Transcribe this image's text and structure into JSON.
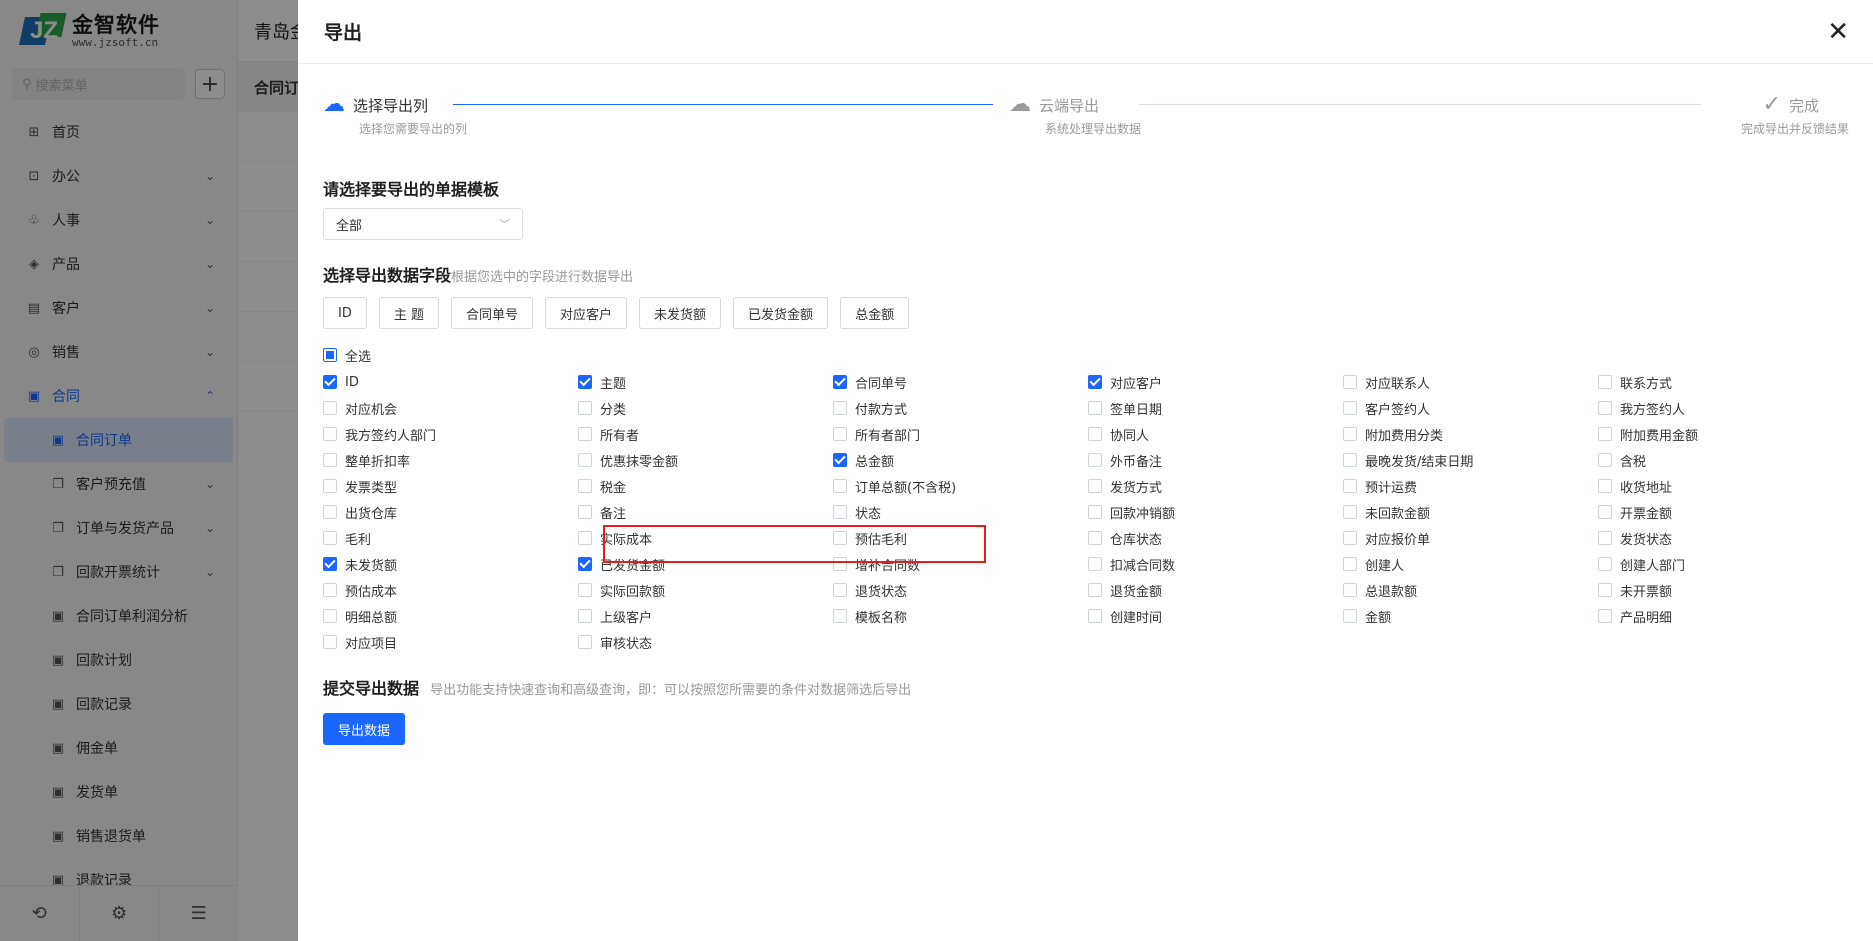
{
  "sidebar": {
    "logo_name": "金智软件",
    "logo_url": "www.jzsoft.cn",
    "search_placeholder": "搜索菜单",
    "items": [
      {
        "label": "首页",
        "icon": "⊞",
        "chev": ""
      },
      {
        "label": "办公",
        "icon": "⊡",
        "chev": "⌄"
      },
      {
        "label": "人事",
        "icon": "♧",
        "chev": "⌄"
      },
      {
        "label": "产品",
        "icon": "◈",
        "chev": "⌄"
      },
      {
        "label": "客户",
        "icon": "▤",
        "chev": "⌄"
      },
      {
        "label": "销售",
        "icon": "◎",
        "chev": "⌄"
      },
      {
        "label": "合同",
        "icon": "▣",
        "chev": "⌃"
      },
      {
        "label": "合同订单",
        "icon": "▣",
        "chev": ""
      },
      {
        "label": "客户预充值",
        "icon": "❐",
        "chev": "⌄"
      },
      {
        "label": "订单与发货产品",
        "icon": "❐",
        "chev": "⌄"
      },
      {
        "label": "回款开票统计",
        "icon": "❐",
        "chev": "⌄"
      },
      {
        "label": "合同订单利润分析",
        "icon": "▣",
        "chev": ""
      },
      {
        "label": "回款计划",
        "icon": "▣",
        "chev": ""
      },
      {
        "label": "回款记录",
        "icon": "▣",
        "chev": ""
      },
      {
        "label": "佣金单",
        "icon": "▣",
        "chev": ""
      },
      {
        "label": "发货单",
        "icon": "▣",
        "chev": ""
      },
      {
        "label": "销售退货单",
        "icon": "▣",
        "chev": ""
      },
      {
        "label": "退款记录",
        "icon": "▣",
        "chev": ""
      }
    ],
    "bottom_icons": [
      "⟲",
      "⚙",
      "☰"
    ]
  },
  "main": {
    "header_title": "青岛金",
    "tab_label": "合同订"
  },
  "drawer": {
    "title": "导出",
    "close_symbol": "✕",
    "steps": [
      {
        "title": "选择导出列",
        "desc": "选择您需要导出的列",
        "icon": "☁"
      },
      {
        "title": "云端导出",
        "desc": "系统处理导出数据",
        "icon": "☁"
      },
      {
        "title": "完成",
        "desc": "完成导出并反馈结果",
        "icon": "✓"
      }
    ],
    "template": {
      "title": "请选择要导出的单据模板",
      "selected": "全部"
    },
    "fields": {
      "title": "选择导出数据字段",
      "hint": "根据您选中的字段进行数据导出",
      "chips": [
        "ID",
        "主 题",
        "合同单号",
        "对应客户",
        "未发货额",
        "已发货金额",
        "总金额"
      ],
      "select_all": "全选",
      "items": [
        {
          "label": "ID",
          "checked": true
        },
        {
          "label": "主题",
          "checked": true
        },
        {
          "label": "合同单号",
          "checked": true
        },
        {
          "label": "对应客户",
          "checked": true
        },
        {
          "label": "对应联系人",
          "checked": false
        },
        {
          "label": "联系方式",
          "checked": false
        },
        {
          "label": "对应机会",
          "checked": false
        },
        {
          "label": "分类",
          "checked": false
        },
        {
          "label": "付款方式",
          "checked": false
        },
        {
          "label": "签单日期",
          "checked": false
        },
        {
          "label": "客户签约人",
          "checked": false
        },
        {
          "label": "我方签约人",
          "checked": false
        },
        {
          "label": "我方签约人部门",
          "checked": false
        },
        {
          "label": "所有者",
          "checked": false
        },
        {
          "label": "所有者部门",
          "checked": false
        },
        {
          "label": "协同人",
          "checked": false
        },
        {
          "label": "附加费用分类",
          "checked": false
        },
        {
          "label": "附加费用金额",
          "checked": false
        },
        {
          "label": "整单折扣率",
          "checked": false
        },
        {
          "label": "优惠抹零金额",
          "checked": false
        },
        {
          "label": "总金额",
          "checked": true
        },
        {
          "label": "外币备注",
          "checked": false
        },
        {
          "label": "最晚发货/结束日期",
          "checked": false
        },
        {
          "label": "含税",
          "checked": false
        },
        {
          "label": "发票类型",
          "checked": false
        },
        {
          "label": "税金",
          "checked": false
        },
        {
          "label": "订单总额(不含税)",
          "checked": false
        },
        {
          "label": "发货方式",
          "checked": false
        },
        {
          "label": "预计运费",
          "checked": false
        },
        {
          "label": "收货地址",
          "checked": false
        },
        {
          "label": "出货仓库",
          "checked": false
        },
        {
          "label": "备注",
          "checked": false
        },
        {
          "label": "状态",
          "checked": false
        },
        {
          "label": "回款冲销额",
          "checked": false
        },
        {
          "label": "未回款金额",
          "checked": false
        },
        {
          "label": "开票金额",
          "checked": false
        },
        {
          "label": "毛利",
          "checked": false
        },
        {
          "label": "实际成本",
          "checked": false
        },
        {
          "label": "预估毛利",
          "checked": false
        },
        {
          "label": "仓库状态",
          "checked": false
        },
        {
          "label": "对应报价单",
          "checked": false
        },
        {
          "label": "发货状态",
          "checked": false
        },
        {
          "label": "未发货额",
          "checked": true
        },
        {
          "label": "已发货金额",
          "checked": true
        },
        {
          "label": "增补合同数",
          "checked": false
        },
        {
          "label": "扣减合同数",
          "checked": false
        },
        {
          "label": "创建人",
          "checked": false
        },
        {
          "label": "创建人部门",
          "checked": false
        },
        {
          "label": "预估成本",
          "checked": false
        },
        {
          "label": "实际回款额",
          "checked": false
        },
        {
          "label": "退货状态",
          "checked": false
        },
        {
          "label": "退货金额",
          "checked": false
        },
        {
          "label": "总退款额",
          "checked": false
        },
        {
          "label": "未开票额",
          "checked": false
        },
        {
          "label": "明细总额",
          "checked": false
        },
        {
          "label": "上级客户",
          "checked": false
        },
        {
          "label": "模板名称",
          "checked": false
        },
        {
          "label": "创建时间",
          "checked": false
        },
        {
          "label": "金额",
          "checked": false
        },
        {
          "label": "产品明细",
          "checked": false
        },
        {
          "label": "对应项目",
          "checked": false
        },
        {
          "label": "审核状态",
          "checked": false
        }
      ]
    },
    "submit": {
      "title": "提交导出数据",
      "hint": "导出功能支持快速查询和高级查询，即：可以按照您所需要的条件对数据筛选后导出",
      "button": "导出数据"
    }
  },
  "colors": {
    "primary": "#1a66ff",
    "highlight": "#e02020"
  }
}
